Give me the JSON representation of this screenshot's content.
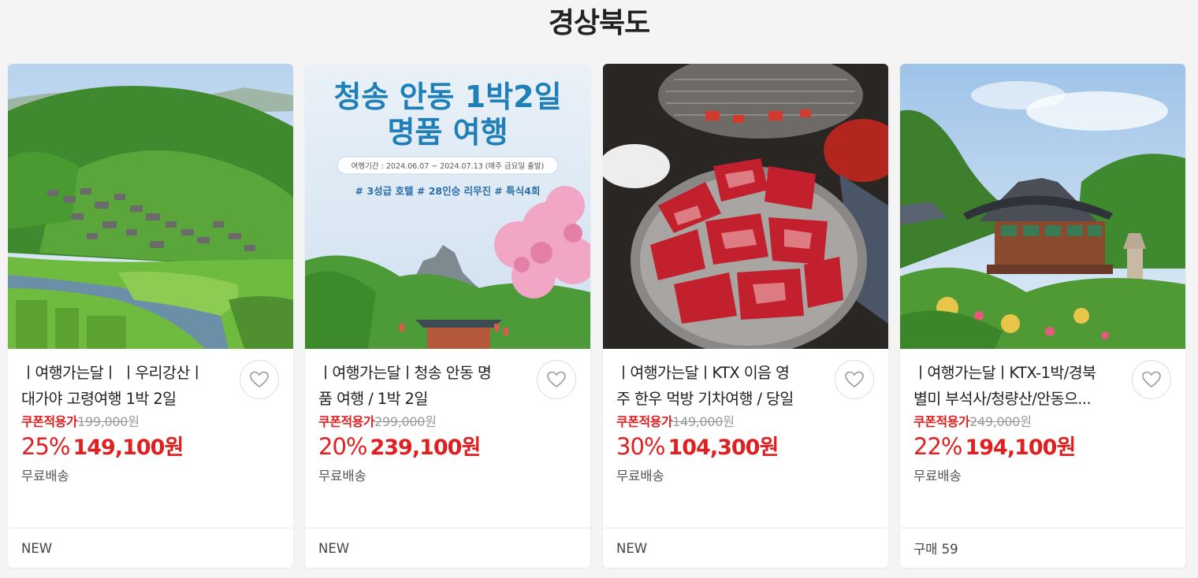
{
  "section": {
    "title": "경상북도"
  },
  "colors": {
    "accent": "#e02020",
    "muted": "#999999"
  },
  "wish_icon": "heart-icon",
  "products": [
    {
      "title_line1": "ㅣ여행가는달ㅣ ㅣ우리강산ㅣ",
      "title_line2": "대가야 고령여행 1박 2일",
      "coupon_label": "쿠폰적용가",
      "original_price": "199,000",
      "original_unit": "원",
      "discount": "25%",
      "sale_price": "149,100원",
      "shipping": "무료배송",
      "footer": "NEW"
    },
    {
      "title_line1": "ㅣ여행가는달ㅣ청송 안동 명",
      "title_line2": "품 여행 / 1박 2일",
      "coupon_label": "쿠폰적용가",
      "original_price": "299,000",
      "original_unit": "원",
      "discount": "20%",
      "sale_price": "239,100원",
      "shipping": "무료배송",
      "footer": "NEW",
      "banner": {
        "headline1": "청송 안동 1박2일",
        "headline2": "명품 여행",
        "period": "여행기간 : 2024.06.07 ~ 2024.07.13 (매주 금요일 출발)",
        "tags": "# 3성급 호텔  # 28인승 리무진  # 특식4회"
      }
    },
    {
      "title_line1": "ㅣ여행가는달ㅣKTX 이음 영",
      "title_line2": "주 한우 먹방 기차여행 / 당일",
      "coupon_label": "쿠폰적용가",
      "original_price": "149,000",
      "original_unit": "원",
      "discount": "30%",
      "sale_price": "104,300원",
      "shipping": "무료배송",
      "footer": "NEW"
    },
    {
      "title_line1": "ㅣ여행가는달ㅣKTX-1박/경북",
      "title_line2": "별미 부석사/청량산/안동으...",
      "coupon_label": "쿠폰적용가",
      "original_price": "249,000",
      "original_unit": "원",
      "discount": "22%",
      "sale_price": "194,100원",
      "shipping": "무료배송",
      "footer": "구매 59"
    }
  ]
}
